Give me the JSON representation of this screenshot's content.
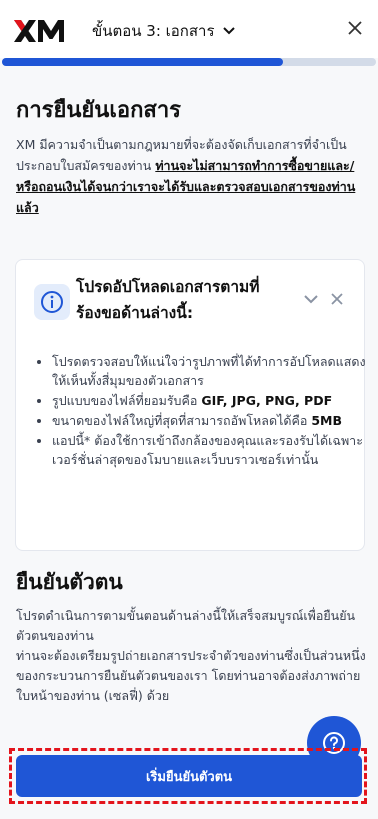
{
  "header": {
    "logo_text": "XM",
    "step_title": "ขั้นตอน 3: เอกสาร",
    "progress_fraction": 0.75
  },
  "documents": {
    "title": "การยืนยันเอกสาร",
    "intro_plain": "XM มีความจำเป็นตามกฎหมายที่จะต้องจัดเก็บเอกสารที่จำเป็นประกอบใบสมัครของท่าน",
    "intro_bold": "ท่านจะไม่สามารถทำการซื้อขายและ/หรือถอนเงินได้จนกว่าเราจะได้รับและตรวจสอบเอกสารของท่านแล้ว"
  },
  "upload_card": {
    "title": "โปรดอัปโหลดเอกสารตามที่ร้องขอด้านล่างนี้:",
    "bullets": [
      {
        "text": "โปรดตรวจสอบให้แน่ใจว่ารูปภาพที่ได้ทำการอัปโหลดแสดงให้เห็นทั้งสี่มุมของตัวเอกสาร",
        "bold": ""
      },
      {
        "text": "รูปแบบของไฟล์ที่ยอมรับคือ",
        "bold": "GIF, JPG, PNG, PDF"
      },
      {
        "text": "ขนาดของไฟล์ใหญ่ที่สุดที่สามารถอัพโหลดได้คือ",
        "bold": "5MB"
      },
      {
        "text": "แอปนี้* ต้องใช้การเข้าถึงกล้องของคุณและรองรับได้เฉพาะเวอร์ชั่นล่าสุดของโมบายและเว็บบราวเซอร์เท่านั้น",
        "bold": ""
      }
    ]
  },
  "identity": {
    "title": "ยืนยันตัวตน",
    "paragraph_1": "โปรดดำเนินการตามขั้นตอนด้านล่างนี้ให้เสร็จสมบูรณ์เพื่อยืนยันตัวตนของท่าน",
    "paragraph_2": "ท่านจะต้องเตรียมรูปถ่ายเอกสารประจำตัวของท่านซึ่งเป็นส่วนหนึ่งของกระบวนการยืนยันตัวตนของเรา โดยท่านอาจต้องส่งภาพถ่ายใบหน้าของท่าน (เซลฟี่) ด้วย"
  },
  "actions": {
    "start_label": "เริ่มยืนยันตัวตน"
  },
  "colors": {
    "accent": "#1f56d6",
    "logo_red": "#e3141c",
    "highlight_outline": "#e3141c"
  }
}
